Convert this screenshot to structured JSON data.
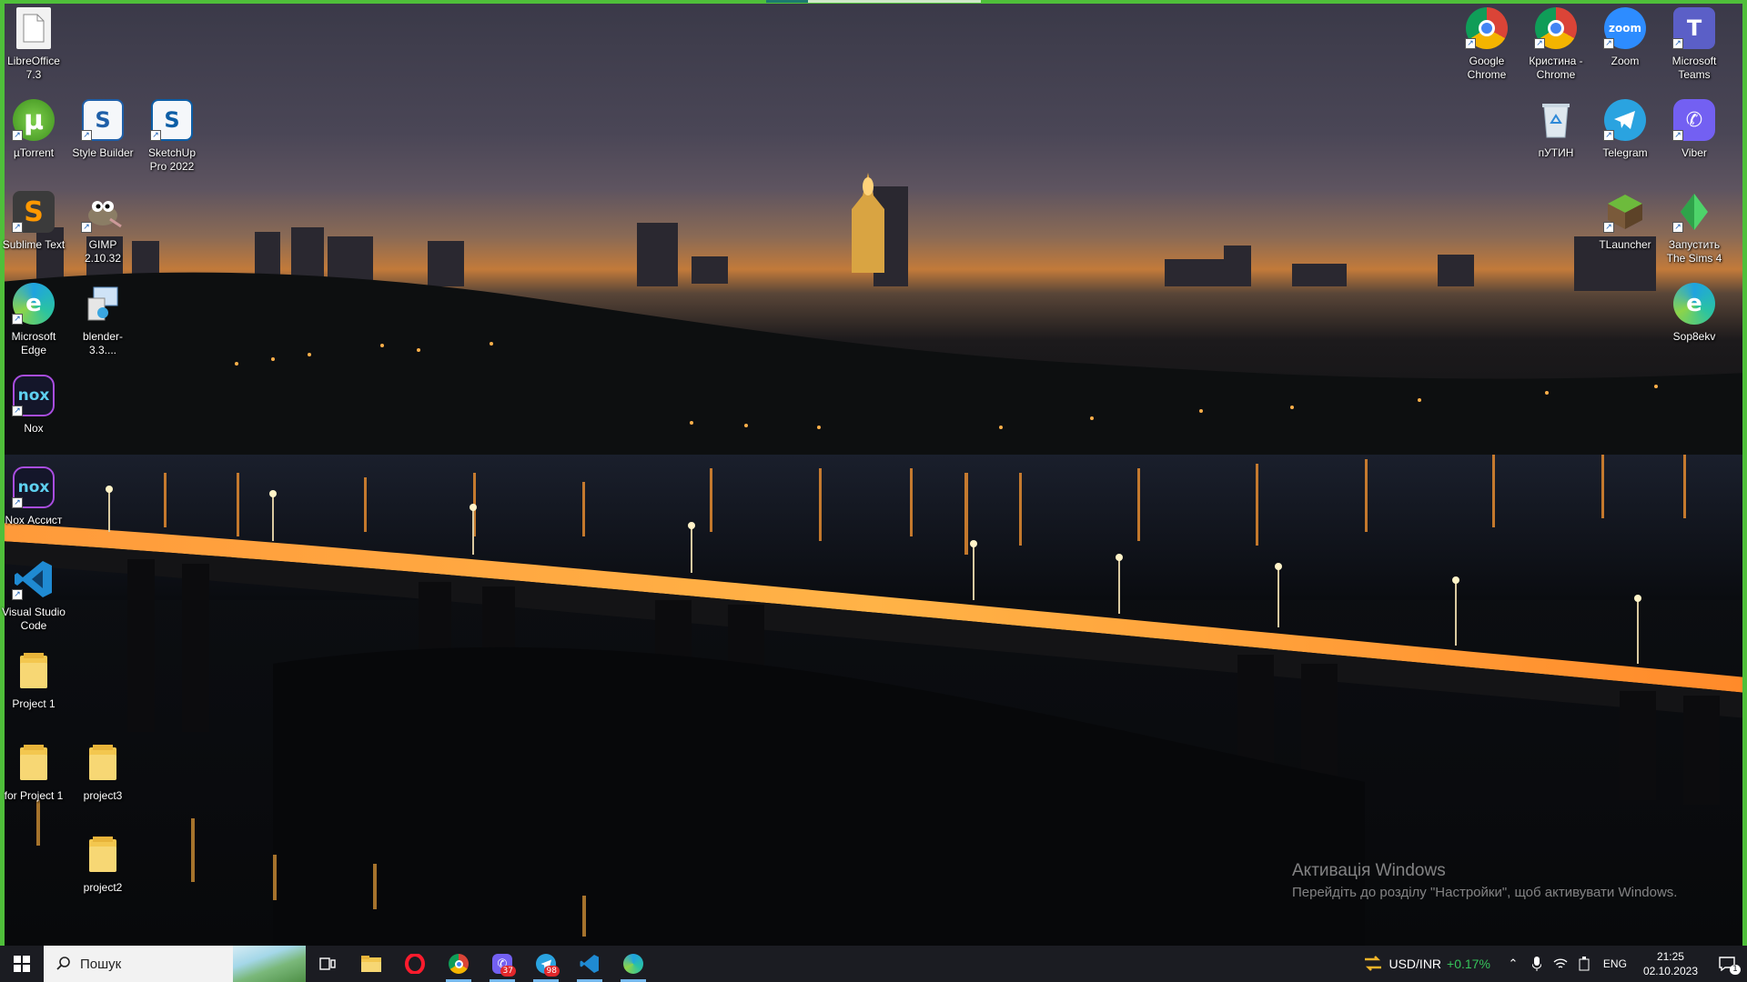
{
  "colors": {
    "taskbar_bg": "#1b1c22",
    "frame_accent": "#4fbf3a",
    "running_indicator": "#76b9ed",
    "stock_change_positive": "#36c35a",
    "notification_badge": "#e1272b"
  },
  "desktop": {
    "left_icons": [
      {
        "label": "LibreOffice 7.3",
        "icon": "libreoffice-file-icon"
      },
      {
        "label": "µTorrent",
        "icon": "utorrent-icon"
      },
      {
        "label": "Style Builder",
        "icon": "style-builder-icon"
      },
      {
        "label": "SketchUp Pro 2022",
        "icon": "sketchup-icon"
      },
      {
        "label": "Sublime Text",
        "icon": "sublime-text-icon"
      },
      {
        "label": "GIMP 2.10.32",
        "icon": "gimp-icon"
      },
      {
        "label": "Microsoft Edge",
        "icon": "edge-icon"
      },
      {
        "label": "blender-3.3....",
        "icon": "blender-installer-icon"
      },
      {
        "label": "Nox",
        "icon": "nox-icon"
      },
      {
        "label": "Nox Ассист",
        "icon": "nox-assist-icon"
      },
      {
        "label": "Visual Studio Code",
        "icon": "vscode-icon"
      },
      {
        "label": "Project 1",
        "icon": "folder-icon"
      },
      {
        "label": "for Project 1",
        "icon": "folder-icon"
      },
      {
        "label": "project3",
        "icon": "folder-icon"
      },
      {
        "label": "project2",
        "icon": "folder-icon"
      }
    ],
    "right_icons": [
      {
        "label": "Google Chrome",
        "icon": "chrome-icon"
      },
      {
        "label": "Кристина - Chrome",
        "icon": "chrome-profile-icon"
      },
      {
        "label": "Zoom",
        "icon": "zoom-icon"
      },
      {
        "label": "Microsoft Teams",
        "icon": "teams-icon"
      },
      {
        "label": "пУТИН",
        "icon": "recycle-bin-icon"
      },
      {
        "label": "Telegram",
        "icon": "telegram-icon"
      },
      {
        "label": "Viber",
        "icon": "viber-icon"
      },
      {
        "label": "TLauncher",
        "icon": "tlauncher-icon"
      },
      {
        "label": "Запустить The Sims 4",
        "icon": "sims4-icon"
      },
      {
        "label": "Sop8ekv",
        "icon": "edge-icon"
      }
    ]
  },
  "activation": {
    "title": "Активація Windows",
    "subtitle": "Перейдіть до розділу \"Настройки\", щоб активувати Windows."
  },
  "taskbar": {
    "search_placeholder": "Пошук",
    "pinned": [
      {
        "name": "task-view",
        "icon": "task-view-icon"
      },
      {
        "name": "file-explorer",
        "icon": "folder-icon"
      },
      {
        "name": "opera",
        "icon": "opera-icon"
      },
      {
        "name": "chrome",
        "icon": "chrome-profile-icon"
      },
      {
        "name": "viber",
        "icon": "viber-icon",
        "badge": "37"
      },
      {
        "name": "telegram",
        "icon": "telegram-icon",
        "badge": "98"
      },
      {
        "name": "vscode",
        "icon": "vscode-icon"
      },
      {
        "name": "edge",
        "icon": "edge-icon"
      }
    ],
    "stock": {
      "pair": "USD/INR",
      "change": "+0.17%"
    },
    "language": "ENG",
    "time": "21:25",
    "date": "02.10.2023",
    "notifications": "1"
  }
}
